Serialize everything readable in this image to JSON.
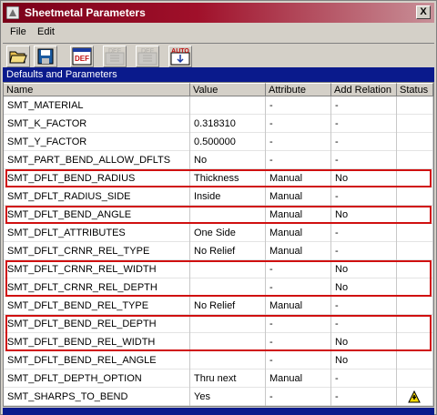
{
  "window": {
    "title": "Sheetmetal Parameters",
    "close_label": "X"
  },
  "menu": {
    "items": [
      "File",
      "Edit"
    ]
  },
  "toolbar": {
    "buttons": [
      {
        "name": "open",
        "label": ""
      },
      {
        "name": "save",
        "label": ""
      },
      {
        "name": "def",
        "label": "DEF"
      },
      {
        "name": "def-2",
        "label": "DEF"
      },
      {
        "name": "def-3",
        "label": "DEF"
      },
      {
        "name": "auto",
        "label": "AUTO"
      }
    ]
  },
  "section": {
    "title": "Defaults and Parameters"
  },
  "table": {
    "columns": [
      "Name",
      "Value",
      "Attribute",
      "Add Relation",
      "Status"
    ],
    "rows": [
      {
        "name": "SMT_MATERIAL",
        "value": "",
        "attribute": "-",
        "add_relation": "-",
        "status": ""
      },
      {
        "name": "SMT_K_FACTOR",
        "value": "0.318310",
        "attribute": "-",
        "add_relation": "-",
        "status": ""
      },
      {
        "name": "SMT_Y_FACTOR",
        "value": "0.500000",
        "attribute": "-",
        "add_relation": "-",
        "status": ""
      },
      {
        "name": "SMT_PART_BEND_ALLOW_DFLTS",
        "value": "No",
        "attribute": "-",
        "add_relation": "-",
        "status": ""
      },
      {
        "name": "SMT_DFLT_BEND_RADIUS",
        "value": "Thickness",
        "attribute": "Manual",
        "add_relation": "No",
        "status": ""
      },
      {
        "name": "SMT_DFLT_RADIUS_SIDE",
        "value": "Inside",
        "attribute": "Manual",
        "add_relation": "-",
        "status": ""
      },
      {
        "name": "SMT_DFLT_BEND_ANGLE",
        "value": "",
        "attribute": "Manual",
        "add_relation": "No",
        "status": ""
      },
      {
        "name": "SMT_DFLT_ATTRIBUTES",
        "value": "One Side",
        "attribute": "Manual",
        "add_relation": "-",
        "status": ""
      },
      {
        "name": "SMT_DFLT_CRNR_REL_TYPE",
        "value": "No Relief",
        "attribute": "Manual",
        "add_relation": "-",
        "status": ""
      },
      {
        "name": "SMT_DFLT_CRNR_REL_WIDTH",
        "value": "",
        "attribute": "-",
        "add_relation": "No",
        "status": ""
      },
      {
        "name": "SMT_DFLT_CRNR_REL_DEPTH",
        "value": "",
        "attribute": "-",
        "add_relation": "No",
        "status": ""
      },
      {
        "name": "SMT_DFLT_BEND_REL_TYPE",
        "value": "No Relief",
        "attribute": "Manual",
        "add_relation": "-",
        "status": ""
      },
      {
        "name": "SMT_DFLT_BEND_REL_DEPTH",
        "value": "",
        "attribute": "-",
        "add_relation": "-",
        "status": ""
      },
      {
        "name": "SMT_DFLT_BEND_REL_WIDTH",
        "value": "",
        "attribute": "-",
        "add_relation": "No",
        "status": ""
      },
      {
        "name": "SMT_DFLT_BEND_REL_ANGLE",
        "value": "",
        "attribute": "-",
        "add_relation": "No",
        "status": ""
      },
      {
        "name": "SMT_DFLT_DEPTH_OPTION",
        "value": "Thru next",
        "attribute": "Manual",
        "add_relation": "-",
        "status": ""
      },
      {
        "name": "SMT_SHARPS_TO_BEND",
        "value": "Yes",
        "attribute": "-",
        "add_relation": "-",
        "status": "warning-icon"
      }
    ]
  },
  "highlight_color": "#d01010",
  "accent_color": "#0a1a8c"
}
